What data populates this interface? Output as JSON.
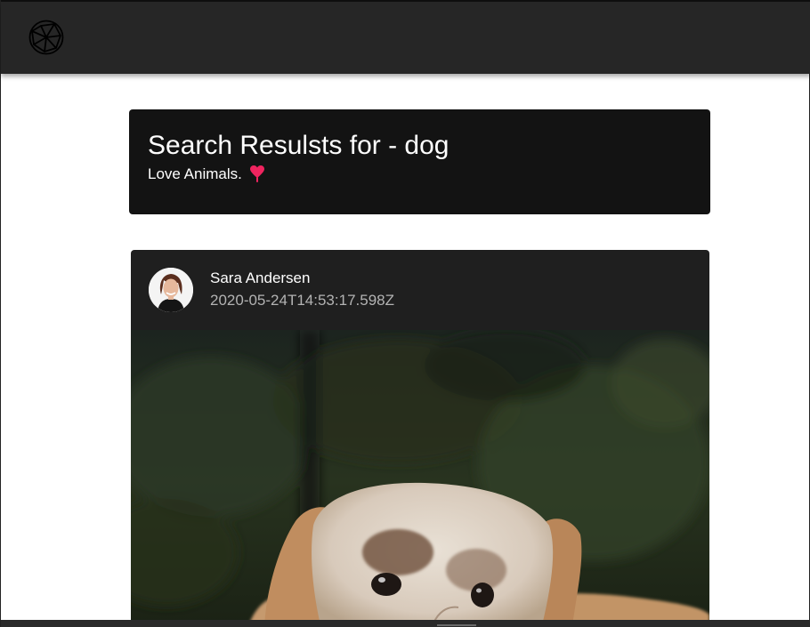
{
  "navbar": {
    "logo_icon": "globe-network-icon",
    "background": "#262626"
  },
  "header": {
    "title": "Search Resulsts for - dog",
    "subtitle": "Love Animals.",
    "subtitle_icon": "heart-icon",
    "heart_color": "#f0245f",
    "background": "#131313"
  },
  "post": {
    "author": "Sara Andersen",
    "timestamp": "2020-05-24T14:53:17.598Z",
    "avatar_icon": "avatar-photo",
    "image_subject": "dog",
    "background": "#1f1f1f"
  }
}
